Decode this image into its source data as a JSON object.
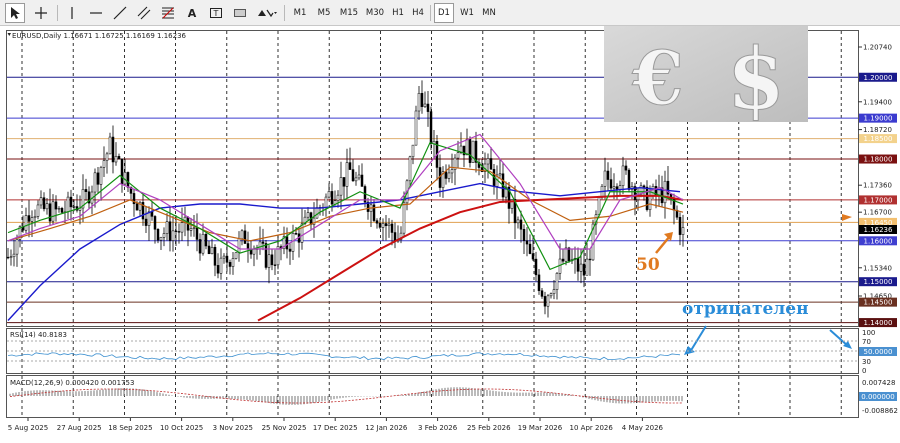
{
  "toolbar": {
    "timeframes": [
      "M1",
      "M5",
      "M15",
      "M30",
      "H1",
      "H4",
      "D1",
      "W1",
      "MN"
    ],
    "active_timeframe": "D1",
    "tools": [
      "cursor-icon",
      "crosshair-icon",
      "vertical-line-icon",
      "horizontal-line-icon",
      "trendline-icon",
      "channel-icon",
      "fibonacci-icon",
      "text-icon",
      "label-icon",
      "rectangle-icon",
      "shapes-icon"
    ]
  },
  "chart": {
    "symbol_header": "EURUSD,Daily  1.16671 1.16725 1.16169 1.16236",
    "price_ticks": [
      "1.20740",
      "1.19400",
      "1.18720",
      "1.17360",
      "1.16700",
      "1.15340",
      "1.14650"
    ],
    "levels": [
      {
        "price": "1.20000",
        "color": "#1a1a8c",
        "label_bg": "#1a1a8c"
      },
      {
        "price": "1.19000",
        "color": "#3b3bcf",
        "label_bg": "#3b3bcf"
      },
      {
        "price": "1.18500",
        "color": "#e0b070",
        "label_bg": "#f3d28c"
      },
      {
        "price": "1.18000",
        "color": "#7a1010",
        "label_bg": "#7a1010"
      },
      {
        "price": "1.17000",
        "color": "#b03030",
        "label_bg": "#b03030"
      },
      {
        "price": "1.16450",
        "color": "#e0a050",
        "label_bg": "#f3c070"
      },
      {
        "price": "1.16000",
        "color": "#3f3fd0",
        "label_bg": "#3f3fd0"
      },
      {
        "price": "1.15000",
        "color": "#1a1a8c",
        "label_bg": "#1a1a8c"
      },
      {
        "price": "1.14500",
        "color": "#6a3020",
        "label_bg": "#6a3020"
      },
      {
        "price": "1.14000",
        "color": "#5a1010",
        "label_bg": "#5a1010"
      }
    ],
    "current_price": "1.16236",
    "annotation_50": "50",
    "annotation_negative": "отрицателен"
  },
  "rsi": {
    "header": "RSI(14) 40.8183",
    "ticks": [
      "100",
      "70",
      "30",
      "0"
    ],
    "level_label": "50.0000"
  },
  "macd": {
    "header": "MACD(12,26,9) 0.000420 0.001753",
    "ticks": [
      "0.007428",
      "0.000000",
      "-0.008862"
    ]
  },
  "dates": [
    "5 Aug 2025",
    "27 Aug 2025",
    "18 Sep 2025",
    "10 Oct 2025",
    "3 Nov 2025",
    "25 Nov 2025",
    "17 Dec 2025",
    "12 Jan 2026",
    "3 Feb 2026",
    "25 Feb 2026",
    "19 Mar 2026",
    "10 Apr 2026",
    "4 May 2026"
  ],
  "image_overlay": {
    "symbols": [
      "€",
      "$"
    ]
  },
  "colors": {
    "sma_long": "#cc1111",
    "sma_mid": "#1a1acc",
    "ma_green": "#109010",
    "ma_violet": "#b040c0",
    "ma_orange": "#c06010",
    "annotation": "#e07a20",
    "annotation_blue": "#2a8cd8"
  }
}
